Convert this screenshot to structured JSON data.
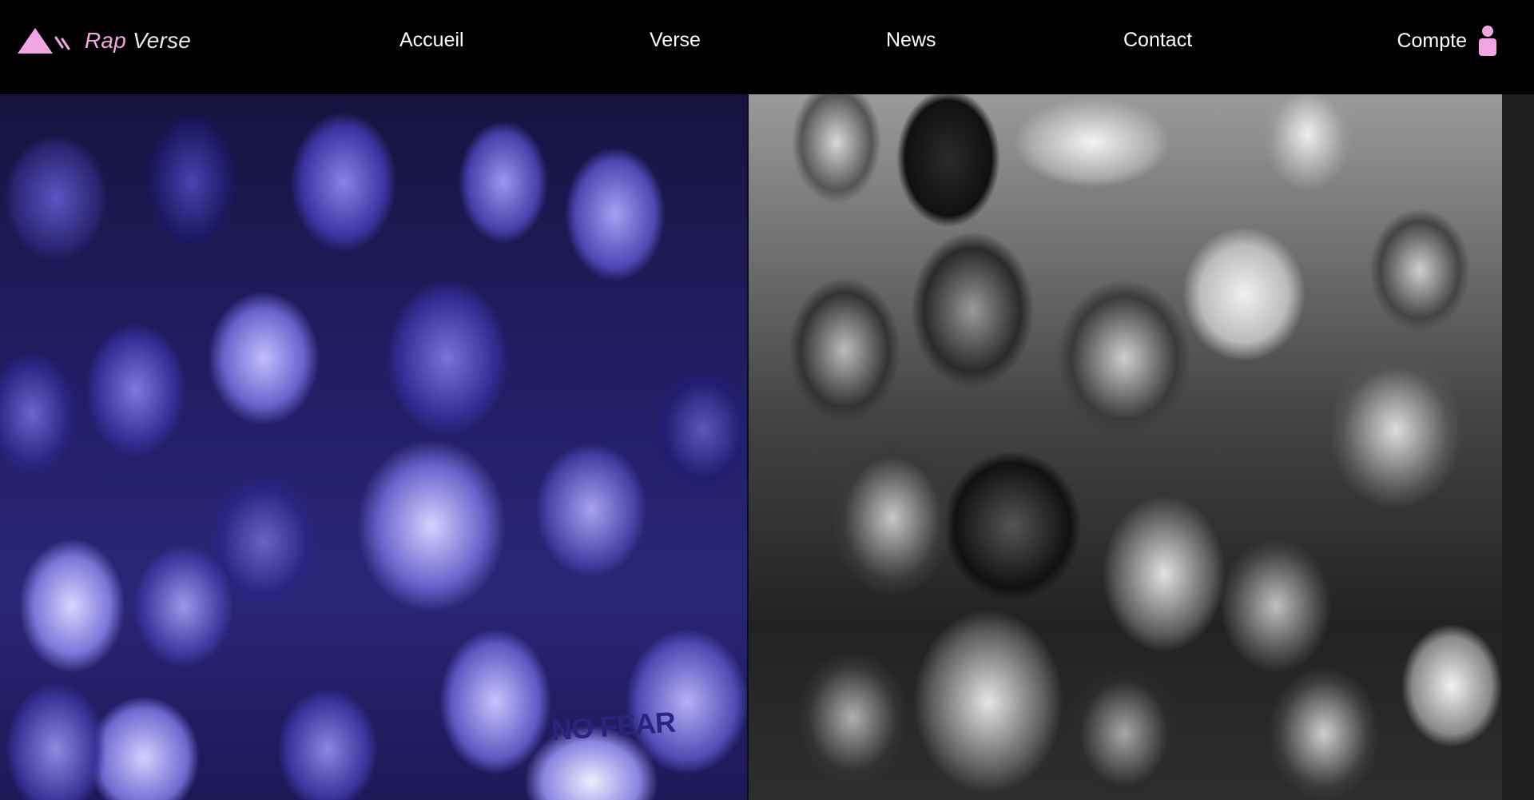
{
  "brand": {
    "name_first": "Rap",
    "name_rest": " Verse",
    "logo_icon": "triangle-logo-icon",
    "accent_color": "#f1a6e3"
  },
  "nav": {
    "items": [
      {
        "label": "Accueil"
      },
      {
        "label": "Verse"
      },
      {
        "label": "News"
      },
      {
        "label": "Contact"
      }
    ]
  },
  "account": {
    "label": "Compte",
    "icon": "user-icon",
    "icon_color": "#f1a6e3"
  },
  "hero": {
    "left_panel_tint": "#4a43b0",
    "right_panel_tint": "grayscale",
    "stamp_text": "NO FEAR"
  }
}
